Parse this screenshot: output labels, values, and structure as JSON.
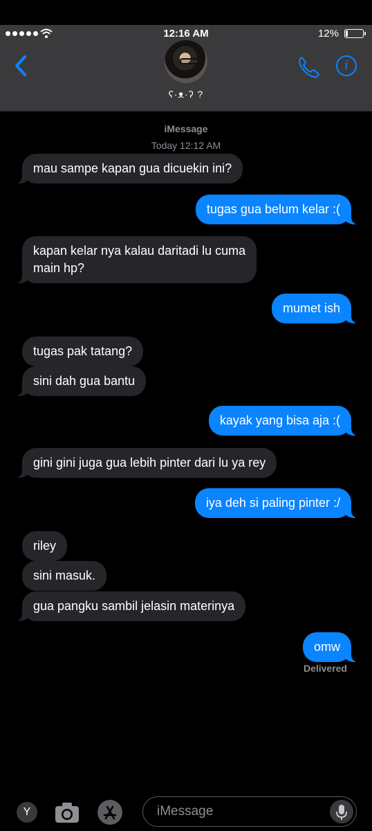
{
  "status_bar": {
    "time": "12:16 AM",
    "battery": "12%",
    "battery_level": 0.12
  },
  "header": {
    "contact_name": "ʕ·ᴥ·ʔ  ?"
  },
  "thread": {
    "service_label": "iMessage",
    "timestamp": "Today 12:12 AM",
    "messages": [
      {
        "from": "them",
        "text": "mau sampe kapan gua dicuekin ini?"
      },
      {
        "from": "me",
        "text": "tugas gua belum kelar :("
      },
      {
        "from": "them",
        "text_lines": [
          "kapan kelar nya kalau daritadi lu cuma",
          "main hp?"
        ]
      },
      {
        "from": "me",
        "text": "mumet ish"
      },
      {
        "from": "them",
        "text": "tugas pak tatang?"
      },
      {
        "from": "them",
        "text": "sini dah gua bantu"
      },
      {
        "from": "me",
        "text": "kayak yang bisa aja :("
      },
      {
        "from": "them",
        "text": "gini gini juga gua lebih pinter dari lu ya rey"
      },
      {
        "from": "me",
        "text": "iya deh si paling pinter :/"
      },
      {
        "from": "them",
        "text": "riley"
      },
      {
        "from": "them",
        "text": "sini masuk."
      },
      {
        "from": "them",
        "text": "gua pangku sambil jelasin materinya"
      },
      {
        "from": "me",
        "text": "omw"
      }
    ],
    "delivered": "Delivered"
  },
  "composer": {
    "app_label": "Y",
    "placeholder": "iMessage"
  },
  "colors": {
    "accent": "#0a84ff",
    "incoming_bubble": "#26252a",
    "header_bg": "#3a3a3c"
  }
}
